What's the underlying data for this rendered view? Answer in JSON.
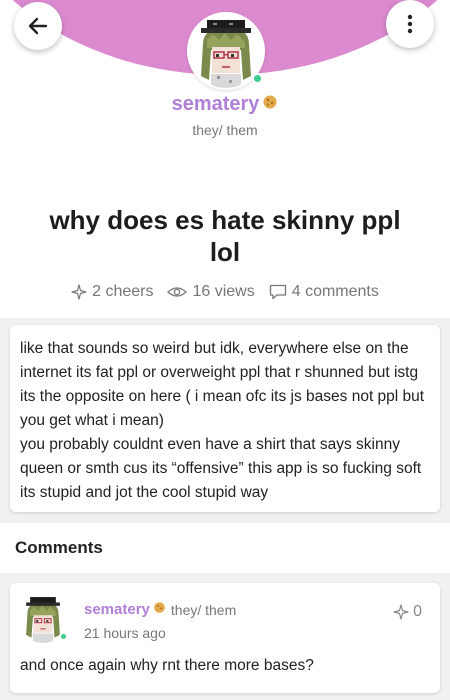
{
  "header": {
    "accent_color": "#dc8ad0",
    "back_icon": "arrow-left-icon",
    "more_icon": "more-vertical-icon"
  },
  "author": {
    "name": "sematery",
    "pronouns": "they/ them",
    "name_color": "#b07fd8",
    "online": true,
    "badge_icon": "cookie-badge-icon"
  },
  "post": {
    "title": "why does es hate skinny ppl lol",
    "body": "like that sounds so weird but idk, everywhere else on the internet its fat ppl or overweight ppl that r shunned but istg its the opposite on here ( i mean ofc its js bases not ppl but you get what i mean)\nyou probably couldnt even have a shirt that says skinny queen or smth cus its “offensive” this app is so fucking soft its stupid and jot the cool stupid way"
  },
  "stats": {
    "cheers": "2 cheers",
    "views": "16 views",
    "comments": "4 comments"
  },
  "comments_section": {
    "heading": "Comments",
    "items": [
      {
        "author": "sematery",
        "pronouns": "they/ them",
        "time": "21 hours ago",
        "cheers": "0",
        "text": "and once again why rnt there more bases?"
      }
    ]
  }
}
